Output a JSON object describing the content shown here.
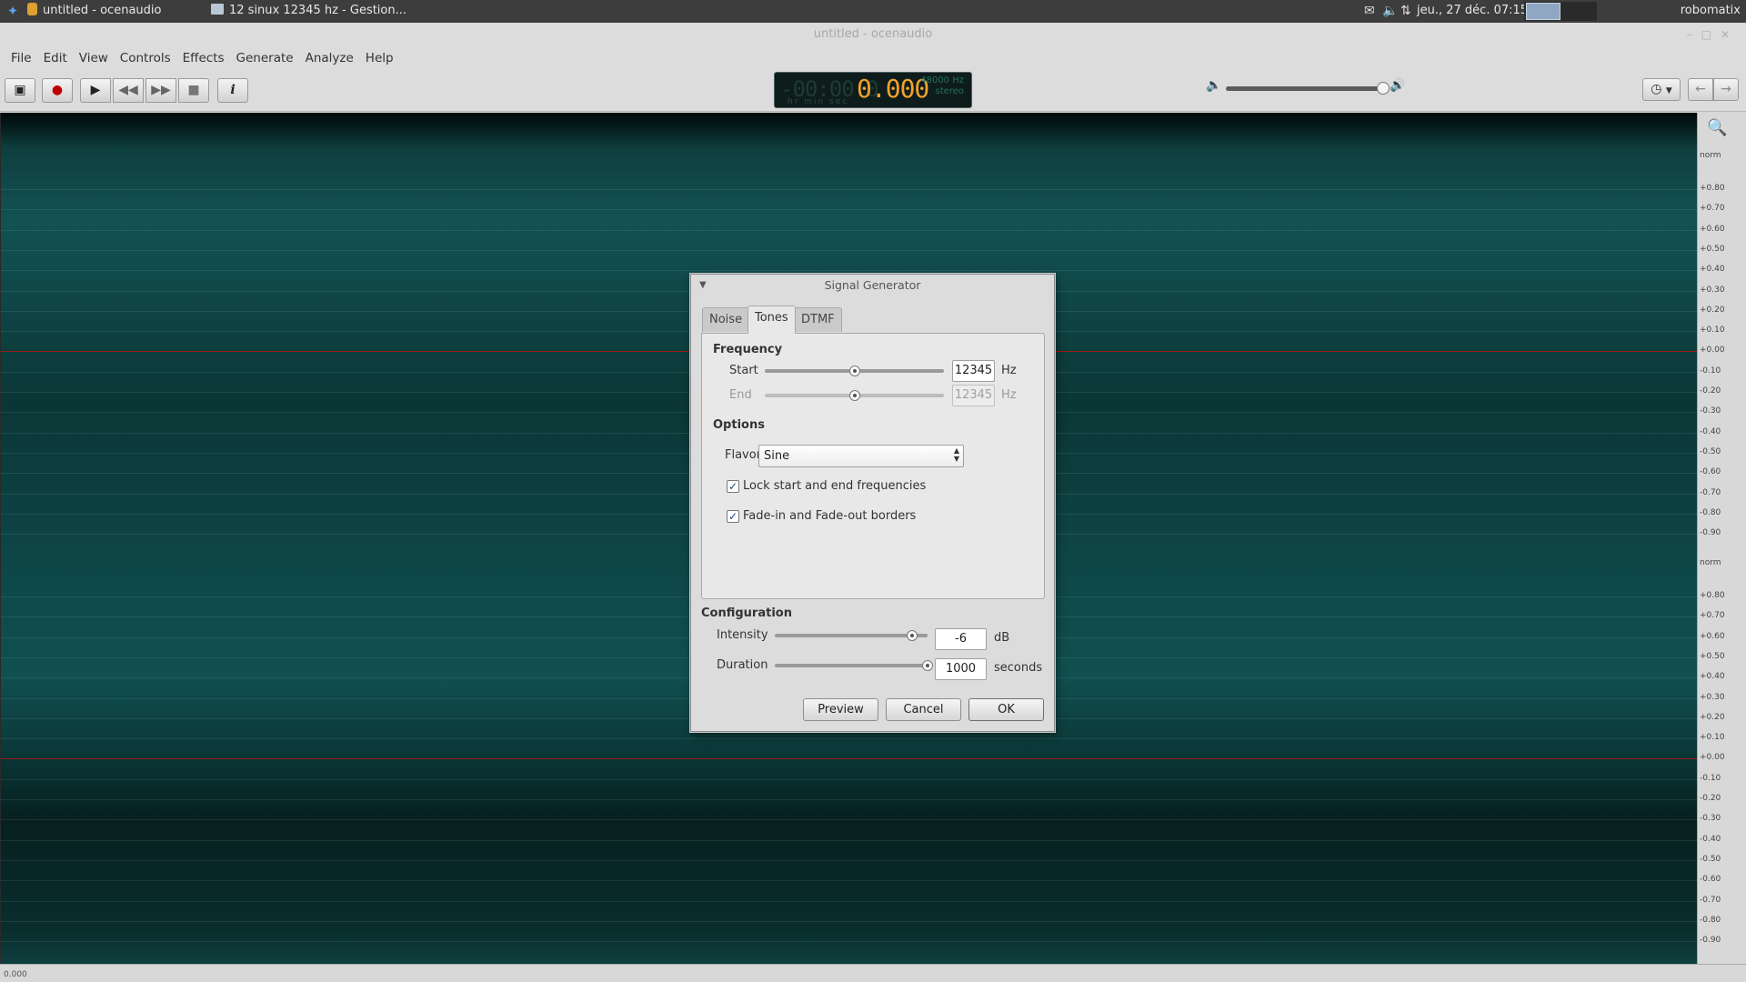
{
  "system_panel": {
    "task1_title": "untitled - ocenaudio",
    "task2_title": "12 sinux 12345 hz - Gestion...",
    "clock": "jeu., 27 déc.  07:15",
    "username": "robomatix"
  },
  "window": {
    "title": "untitled - ocenaudio",
    "menu": [
      "File",
      "Edit",
      "View",
      "Controls",
      "Effects",
      "Generate",
      "Analyze",
      "Help"
    ]
  },
  "time_display": {
    "ghost": "-00:00:0",
    "value": "0.000",
    "units": "hr  min  sec",
    "sample_rate": "48000 Hz",
    "channels": "stereo"
  },
  "waveform": {
    "start_time": "0.000",
    "channel1_scale": [
      "norm",
      "+0.80",
      "+0.70",
      "+0.60",
      "+0.50",
      "+0.40",
      "+0.30",
      "+0.20",
      "+0.10",
      "+0.00",
      "-0.10",
      "-0.20",
      "-0.30",
      "-0.40",
      "-0.50",
      "-0.60",
      "-0.70",
      "-0.80",
      "-0.90"
    ],
    "channel2_scale": [
      "norm",
      "+0.80",
      "+0.70",
      "+0.60",
      "+0.50",
      "+0.40",
      "+0.30",
      "+0.20",
      "+0.10",
      "+0.00",
      "-0.10",
      "-0.20",
      "-0.30",
      "-0.40",
      "-0.50",
      "-0.60",
      "-0.70",
      "-0.80",
      "-0.90"
    ]
  },
  "dialog": {
    "title": "Signal Generator",
    "tabs": [
      "Noise",
      "Tones",
      "DTMF"
    ],
    "active_tab": "Tones",
    "frequency": {
      "title": "Frequency",
      "start_label": "Start",
      "start_value": "12345",
      "start_unit": "Hz",
      "start_slider_fraction": 0.5,
      "end_label": "End",
      "end_value": "12345",
      "end_unit": "Hz",
      "end_slider_fraction": 0.5
    },
    "options": {
      "title": "Options",
      "flavor_label": "Flavor",
      "flavor_value": "Sine",
      "lock_label": "Lock start and end frequencies",
      "lock_checked": true,
      "fade_label": "Fade-in and Fade-out borders",
      "fade_checked": true
    },
    "configuration": {
      "title": "Configuration",
      "intensity_label": "Intensity",
      "intensity_value": "-6",
      "intensity_unit": "dB",
      "intensity_slider_fraction": 0.9,
      "duration_label": "Duration",
      "duration_value": "1000",
      "duration_unit": "seconds",
      "duration_slider_fraction": 1.0
    },
    "buttons": {
      "preview": "Preview",
      "cancel": "Cancel",
      "ok": "OK"
    }
  }
}
